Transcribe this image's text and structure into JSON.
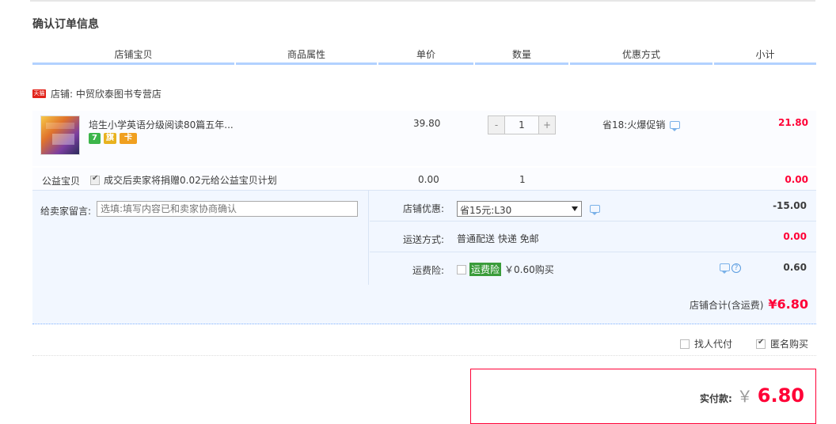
{
  "section_title": "确认订单信息",
  "columns": [
    "店铺宝贝",
    "商品属性",
    "单价",
    "数量",
    "优惠方式",
    "小计"
  ],
  "shop": {
    "badge": "天猫",
    "label": "店铺: 中贸欣泰图书专营店"
  },
  "product": {
    "title": "培生小学英语分级阅读80篇五年...",
    "icons": [
      "7",
      "旗",
      "卡"
    ],
    "unit_price": "39.80",
    "qty_minus": "-",
    "quantity": "1",
    "qty_plus": "+",
    "promo": "省18:火爆促销",
    "subtotal": "21.80"
  },
  "charity": {
    "label": "公益宝贝",
    "option": "成交后卖家将捐赠0.02元给公益宝贝计划",
    "price": "0.00",
    "qty": "1",
    "subtotal": "0.00"
  },
  "message": {
    "label": "给卖家留言:",
    "placeholder": "选填:填写内容已和卖家协商确认"
  },
  "shop_discount": {
    "label": "店铺优惠:",
    "selected": "省15元:L30",
    "amount": "-15.00"
  },
  "shipping": {
    "label": "运送方式:",
    "value": "普通配送 快递 免邮",
    "amount": "0.00"
  },
  "insurance": {
    "label": "运费险:",
    "badge": "运费险",
    "value": "￥0.60购买",
    "amount": "0.60"
  },
  "shop_total": {
    "label": "店铺合计(含运费)",
    "amount": "¥6.80"
  },
  "options": {
    "proxy_pay": "找人代付",
    "anonymous": "匿名购买"
  },
  "payment": {
    "label": "实付款:",
    "currency": "￥",
    "amount": "6.80"
  },
  "colors": {
    "accent": "#ff0036",
    "header_line": "#b2d1ff",
    "block_bg": "#f2f7ff"
  }
}
